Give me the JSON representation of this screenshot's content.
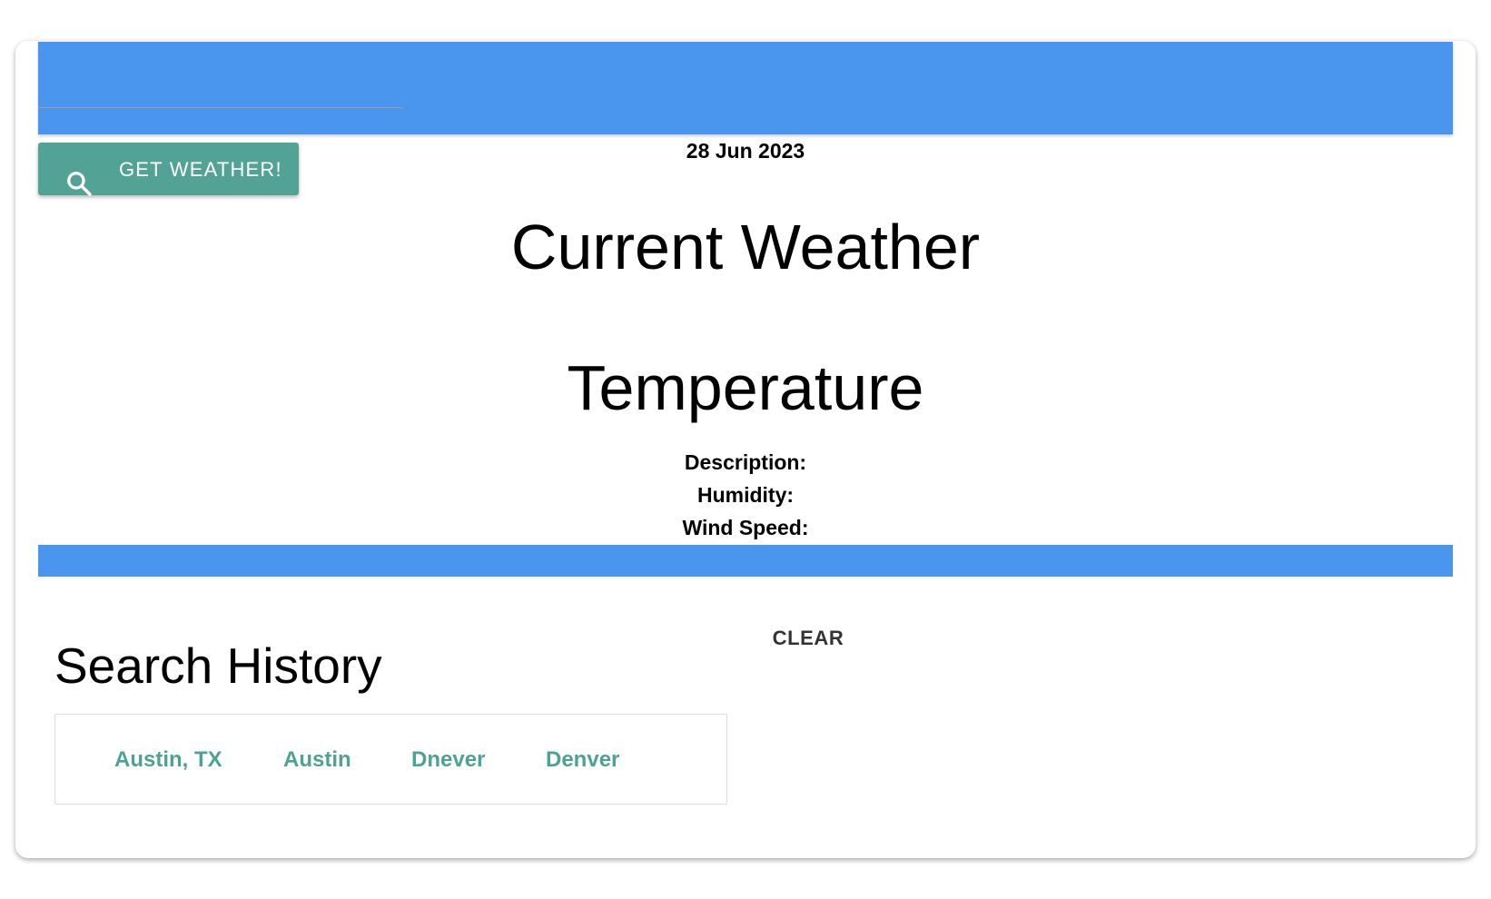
{
  "toolbar": {
    "button_label": "GET WEATHER!",
    "button_icon": "search-icon"
  },
  "weather": {
    "date": "28 Jun 2023",
    "heading": "Current Weather",
    "temperature_heading": "Temperature",
    "description_label": "Description:",
    "humidity_label": "Humidity:",
    "wind_speed_label": "Wind Speed:"
  },
  "history": {
    "title": "Search History",
    "clear_label": "CLEAR",
    "items": [
      "Austin, TX",
      "Austin",
      "Dnever",
      "Denver"
    ]
  },
  "colors": {
    "bar_blue": "#4a95ed",
    "button_teal": "#52a395",
    "link_teal": "#4da393"
  }
}
